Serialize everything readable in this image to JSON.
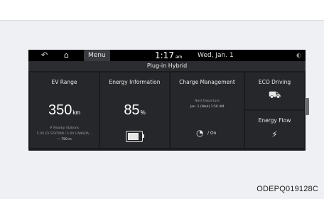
{
  "status_bar": {
    "back_icon": "back-arrow-icon",
    "home_icon": "home-icon",
    "menu_label": "Menu",
    "time": "1:17",
    "ampm": "am",
    "date": "Wed, Jan. 1"
  },
  "title": "Plug-in Hybrid",
  "tiles": {
    "ev_range": {
      "label": "EV Range",
      "value": "350",
      "unit": "km",
      "sub1": "# Nearby Stations",
      "sub2": "5.0X EV STATION / 5.0X CANADA...",
      "sub3": "— 750 m"
    },
    "energy_information": {
      "label": "Energy Information",
      "value": "85",
      "unit": "%",
      "battery_level": 0.85
    },
    "charge_management": {
      "label": "Charge Management",
      "sub1": "Next Departure",
      "sub2": "Jan. 1 (Wed) 1:50 AM",
      "state": "/ On"
    },
    "eco_driving": {
      "label": "ECO Driving"
    },
    "energy_flow": {
      "label": "Energy Flow"
    }
  },
  "caption": "ODEPQ019128C",
  "colors": {
    "screen_bg": "#1a1b1d",
    "tile_bg": "#26272a",
    "page_bg": "#eef0f3"
  }
}
